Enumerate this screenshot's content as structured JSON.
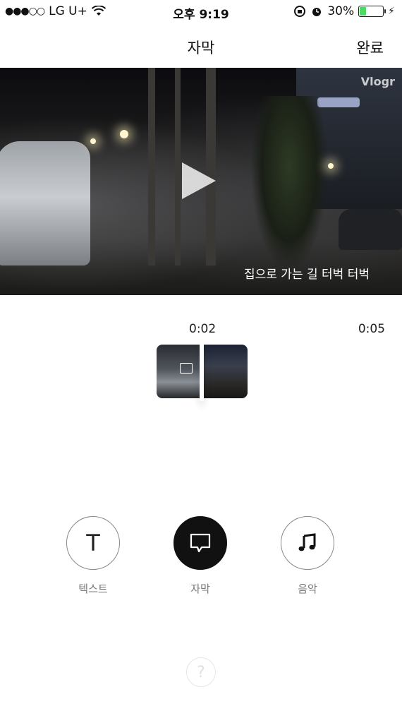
{
  "status_bar": {
    "signal": "●●●○○",
    "carrier": "LG U+",
    "time": "오후 9:19",
    "battery_percent": "30%",
    "battery_level": 0.3,
    "accent_battery": "#4cd964"
  },
  "nav": {
    "title": "자막",
    "done_label": "완료"
  },
  "video": {
    "watermark": "Vlogr",
    "caption": "집으로 가는 길 터벅 터벅"
  },
  "timeline": {
    "current_time": "0:02",
    "end_time": "0:05"
  },
  "modes": [
    {
      "label": "텍스트",
      "icon": "T",
      "active": false
    },
    {
      "label": "자막",
      "icon": "subtitle-icon",
      "active": true
    },
    {
      "label": "음악",
      "icon": "music-note-icon",
      "active": false
    }
  ],
  "help": {
    "symbol": "?"
  }
}
